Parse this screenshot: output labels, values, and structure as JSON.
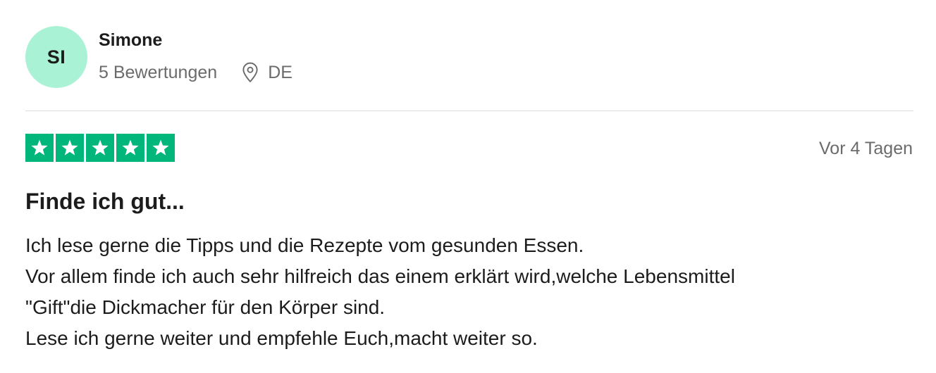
{
  "reviewer": {
    "initials": "SI",
    "name": "Simone",
    "review_count": "5 Bewertungen",
    "country": "DE",
    "avatar_color": "#a9f2d6"
  },
  "review": {
    "rating": 5,
    "rating_max": 5,
    "star_color": "#00b67a",
    "date": "Vor 4 Tagen",
    "title": "Finde ich gut...",
    "body_lines": [
      "Ich lese gerne die Tipps und die Rezepte vom gesunden Essen.",
      "Vor allem finde ich auch sehr hilfreich das einem erklärt wird,welche Lebensmittel",
      "\"Gift\"die Dickmacher für den Körper sind.",
      "Lese ich gerne weiter und empfehle Euch,macht weiter so."
    ]
  },
  "icons": {
    "location": "location-pin-icon",
    "star": "star-icon"
  }
}
